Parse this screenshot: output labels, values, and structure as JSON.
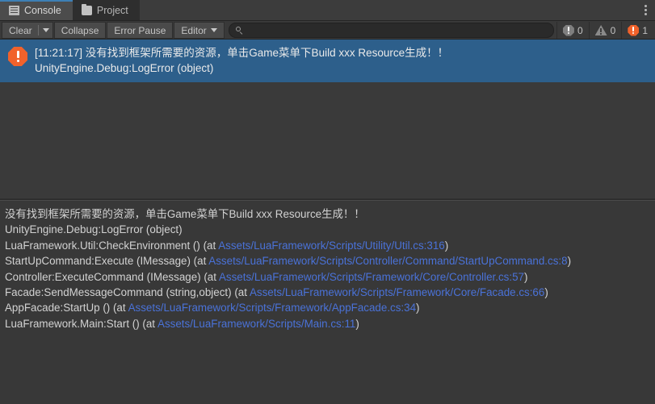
{
  "window": {
    "tabs": [
      {
        "label": "Console",
        "icon": "console-icon",
        "active": true
      },
      {
        "label": "Project",
        "icon": "folder-icon",
        "active": false
      }
    ],
    "menu_icon": "kebab-menu-icon"
  },
  "toolbar": {
    "clear_label": "Clear",
    "clear_dropdown_icon": "chevron-down-icon",
    "collapse_label": "Collapse",
    "error_pause_label": "Error Pause",
    "editor_label": "Editor",
    "editor_dropdown_icon": "chevron-down-icon",
    "search": {
      "value": "",
      "placeholder": "",
      "icon": "search-icon"
    },
    "counters": {
      "error_icon": "error-octagon-icon",
      "error_count": "0",
      "warning_icon": "warning-triangle-icon",
      "warning_count": "0",
      "info_icon": "error-octagon-active-icon",
      "info_count": "1"
    }
  },
  "log_list": {
    "entries": [
      {
        "icon": "error-octagon-icon",
        "selected": true,
        "line1": "[11:21:17] 没有找到框架所需要的资源，单击Game菜单下Build xxx Resource生成！！",
        "line2": "UnityEngine.Debug:LogError (object)"
      }
    ]
  },
  "detail_panel": {
    "lines": [
      {
        "segments": [
          {
            "text": "没有找到框架所需要的资源，单击Game菜单下Build xxx Resource生成！！",
            "link": false
          }
        ]
      },
      {
        "segments": [
          {
            "text": "UnityEngine.Debug:LogError (object)",
            "link": false
          }
        ]
      },
      {
        "segments": [
          {
            "text": "LuaFramework.Util:CheckEnvironment () (at ",
            "link": false
          },
          {
            "text": "Assets/LuaFramework/Scripts/Utility/Util.cs:316",
            "link": true
          },
          {
            "text": ")",
            "link": false
          }
        ]
      },
      {
        "segments": [
          {
            "text": "StartUpCommand:Execute (IMessage) (at ",
            "link": false
          },
          {
            "text": "Assets/LuaFramework/Scripts/Controller/Command/StartUpCommand.cs:8",
            "link": true
          },
          {
            "text": ")",
            "link": false
          }
        ]
      },
      {
        "segments": [
          {
            "text": "Controller:ExecuteCommand (IMessage) (at ",
            "link": false
          },
          {
            "text": "Assets/LuaFramework/Scripts/Framework/Core/Controller.cs:57",
            "link": true
          },
          {
            "text": ")",
            "link": false
          }
        ]
      },
      {
        "segments": [
          {
            "text": "Facade:SendMessageCommand (string,object) (at ",
            "link": false
          },
          {
            "text": "Assets/LuaFramework/Scripts/Framework/Core/Facade.cs:66",
            "link": true
          },
          {
            "text": ")",
            "link": false
          }
        ]
      },
      {
        "segments": [
          {
            "text": "AppFacade:StartUp () (at ",
            "link": false
          },
          {
            "text": "Assets/LuaFramework/Scripts/Framework/AppFacade.cs:34",
            "link": true
          },
          {
            "text": ")",
            "link": false
          }
        ]
      },
      {
        "segments": [
          {
            "text": "LuaFramework.Main:Start () (at ",
            "link": false
          },
          {
            "text": "Assets/LuaFramework/Scripts/Main.cs:11",
            "link": true
          },
          {
            "text": ")",
            "link": false
          }
        ]
      }
    ]
  },
  "colors": {
    "selection_blue": "#2d5f8b",
    "error_orange": "#f1622b",
    "link_blue": "#4a72d8",
    "tab_accent": "#3d7fb5",
    "panel_bg": "#383838",
    "list_bg": "#3a3a3a"
  }
}
